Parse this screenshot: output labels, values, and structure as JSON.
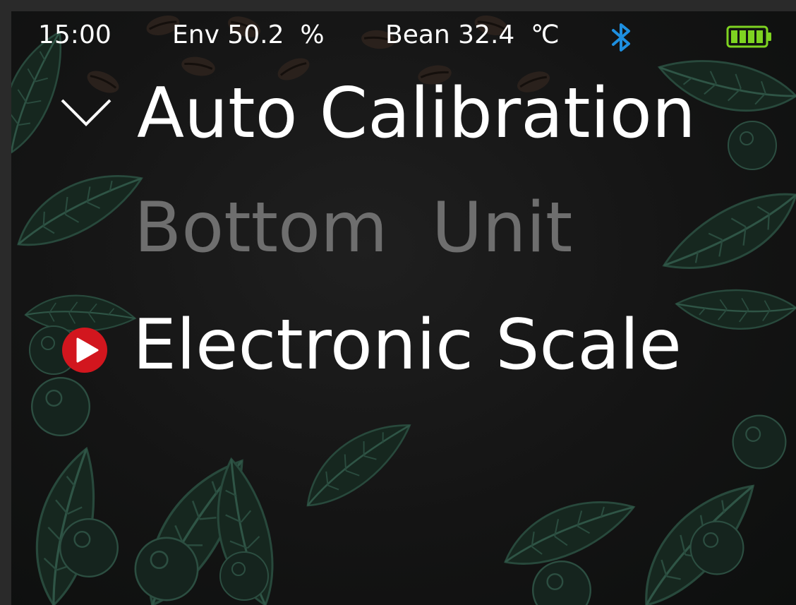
{
  "status_bar": {
    "time": "15:00",
    "env": "Env 50.2  %",
    "bean": "Bean 32.4  ℃",
    "bluetooth_icon": "bluetooth-icon",
    "battery_icon": "battery-icon",
    "bluetooth_color": "#1e8fe0",
    "battery_color": "#7ed321",
    "battery_level": 1.0
  },
  "menu": {
    "items": [
      {
        "label": "Auto Calibration",
        "marker": "chevron-down-icon",
        "state": "enabled"
      },
      {
        "label": "Bottom  Unit",
        "marker": "",
        "state": "disabled"
      },
      {
        "label": "Electronic Scale",
        "marker": "play-circle-icon",
        "state": "selected"
      }
    ]
  },
  "colors": {
    "text_active": "#ffffff",
    "text_disabled": "#6e6e6e",
    "selection_marker": "#d2161e",
    "leaf": "#1d3a30"
  }
}
